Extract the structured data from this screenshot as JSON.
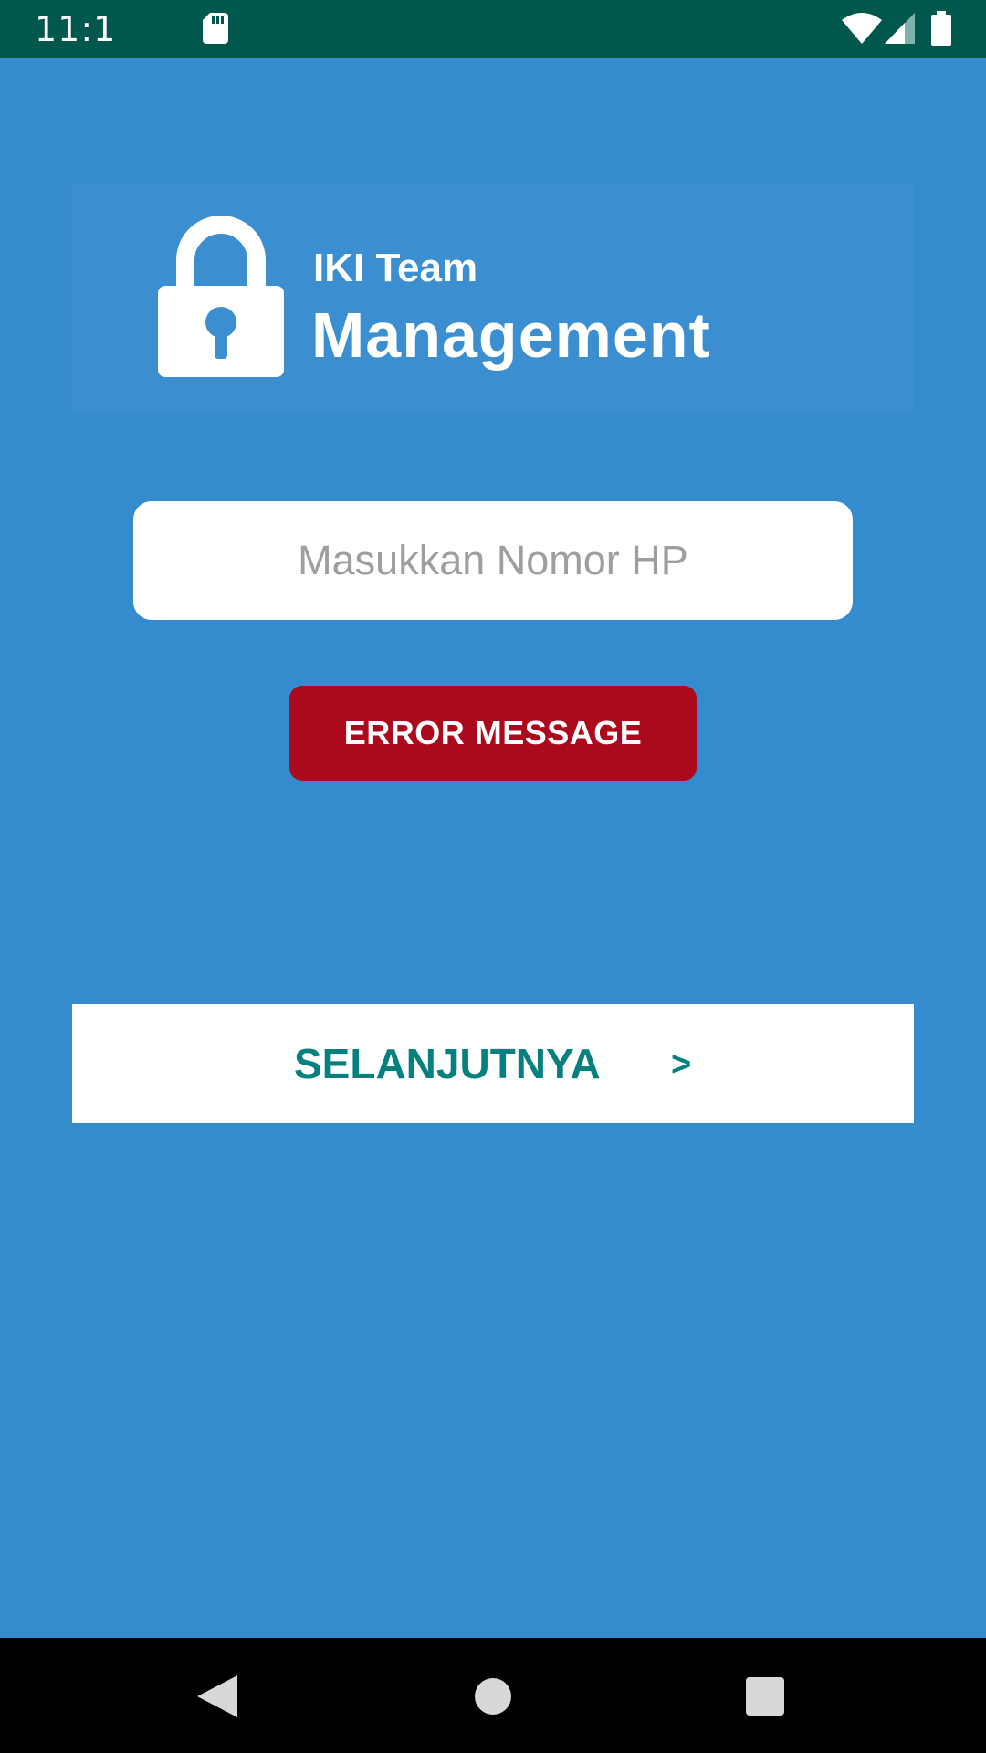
{
  "status_bar": {
    "time": "11:1",
    "icons": [
      "sd-card-icon",
      "wifi-icon",
      "signal-icon",
      "battery-icon"
    ]
  },
  "logo": {
    "icon": "lock-icon",
    "line1": "IKI Team",
    "line2": "Management"
  },
  "form": {
    "phone_placeholder": "Masukkan Nomor HP",
    "phone_value": "",
    "error_label": "ERROR MESSAGE",
    "next_label": "SELANJUTNYA",
    "next_arrow": ">"
  },
  "nav_bar": {
    "icons": [
      "back-icon",
      "home-icon",
      "recents-icon"
    ]
  },
  "colors": {
    "status_bar": "#00574b",
    "background": "#348bcd",
    "error": "#aa0a1c",
    "accent_text": "#067f7f",
    "white": "#ffffff"
  }
}
